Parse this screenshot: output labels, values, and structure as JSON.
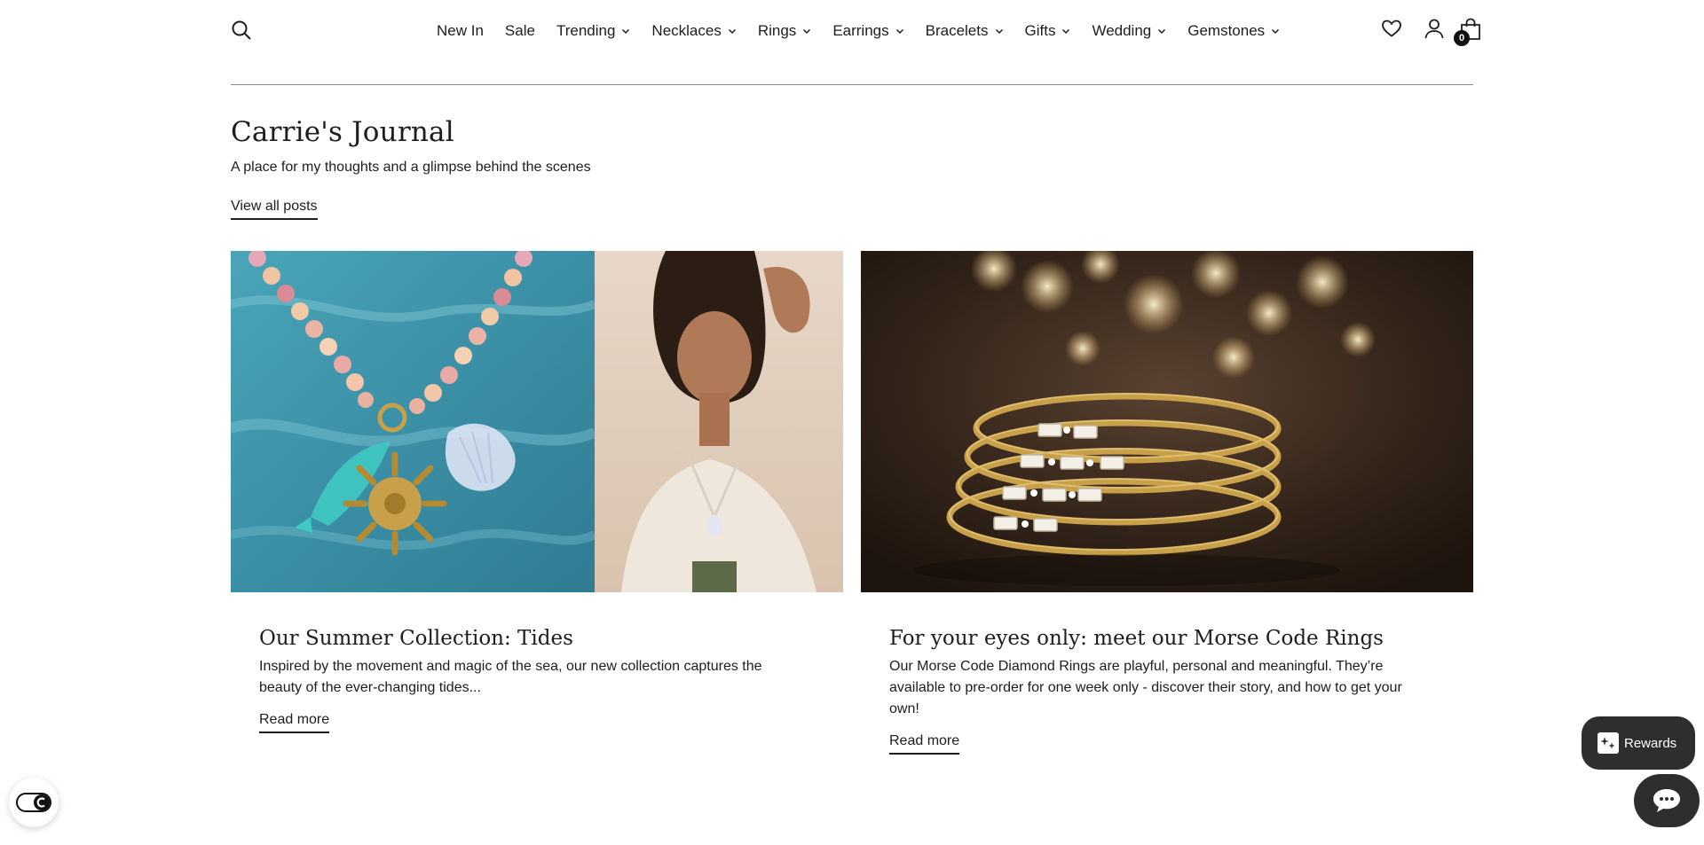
{
  "header": {
    "nav": [
      {
        "label": "New In",
        "dropdown": false
      },
      {
        "label": "Sale",
        "dropdown": false
      },
      {
        "label": "Trending",
        "dropdown": true
      },
      {
        "label": "Necklaces",
        "dropdown": true
      },
      {
        "label": "Rings",
        "dropdown": true
      },
      {
        "label": "Earrings",
        "dropdown": true
      },
      {
        "label": "Bracelets",
        "dropdown": true
      },
      {
        "label": "Gifts",
        "dropdown": true
      },
      {
        "label": "Wedding",
        "dropdown": true
      },
      {
        "label": "Gemstones",
        "dropdown": true
      }
    ],
    "cart_count": "0",
    "icons": [
      "search-icon",
      "heart-icon",
      "account-icon",
      "bag-icon",
      "chevron-down-icon"
    ]
  },
  "journal": {
    "title": "Carrie's Journal",
    "subtitle": "A place for my thoughts and a glimpse behind the scenes",
    "view_all": "View all posts"
  },
  "posts": [
    {
      "title": "Our Summer Collection: Tides",
      "excerpt": "Inspired by the movement and magic of the sea, our new collection captures the beauty of the ever-changing tides...",
      "read_more": "Read more"
    },
    {
      "title": "For your eyes only: meet our Morse Code Rings",
      "excerpt": "Our Morse Code Diamond Rings are playful, personal and meaningful. They’re available to pre-order for one week only - discover their story, and how to get your own!",
      "read_more": "Read more"
    }
  ],
  "widgets": {
    "rewards_label": "Rewards",
    "accessibility_icon": "accessibility-toggle-icon",
    "chat_icon": "chat-icon"
  },
  "colors": {
    "text": "#1d1d1d",
    "widget_bg": "#2e2e2e",
    "sea_blue": "#3e9bb0",
    "gold": "#c9a04a",
    "dark_bg": "#2a1d12"
  }
}
